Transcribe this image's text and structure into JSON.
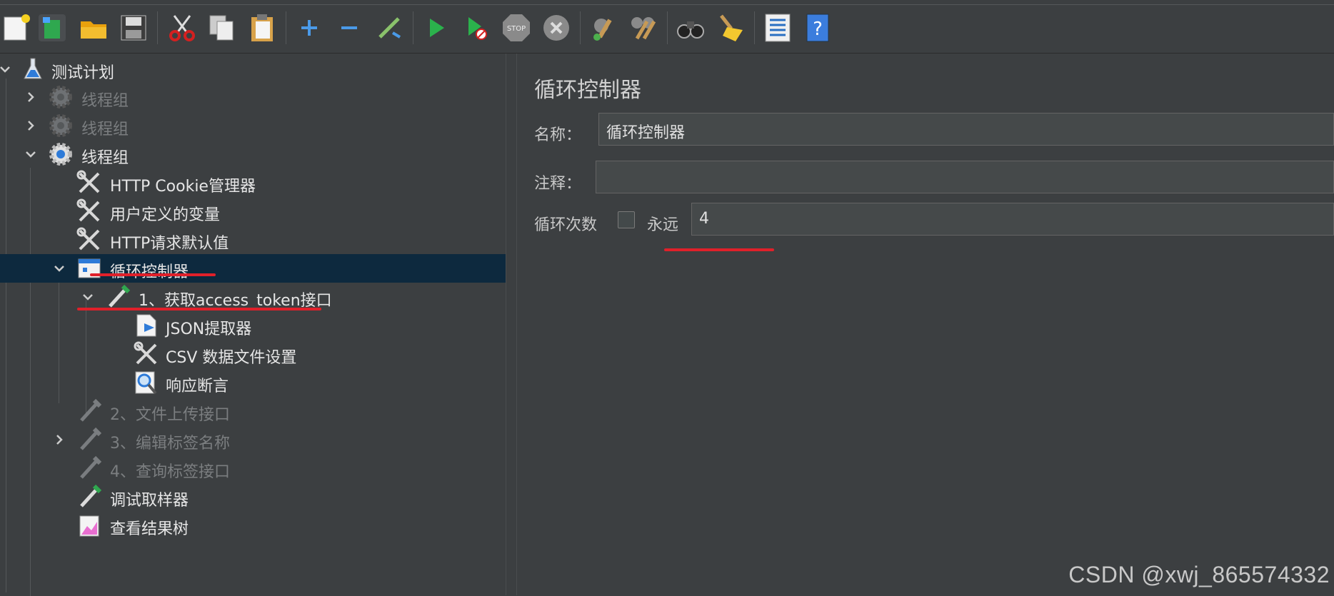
{
  "toolbar": {
    "buttons": [
      {
        "name": "new-icon"
      },
      {
        "name": "templates-icon"
      },
      {
        "name": "open-icon"
      },
      {
        "name": "save-icon"
      },
      {
        "name": "cut-icon"
      },
      {
        "name": "copy-icon"
      },
      {
        "name": "paste-icon"
      },
      {
        "name": "expand-icon"
      },
      {
        "name": "collapse-icon"
      },
      {
        "name": "toggle-icon"
      },
      {
        "name": "start-icon"
      },
      {
        "name": "start-no-pause-icon"
      },
      {
        "name": "stop-icon"
      },
      {
        "name": "shutdown-icon"
      },
      {
        "name": "clear-icon"
      },
      {
        "name": "clear-all-icon"
      },
      {
        "name": "search-icon"
      },
      {
        "name": "reset-search-icon"
      },
      {
        "name": "function-helper-icon"
      },
      {
        "name": "help-icon"
      }
    ]
  },
  "tree": {
    "root": "测试计划",
    "thread_group_1": "线程组",
    "thread_group_2": "线程组",
    "thread_group_3": "线程组",
    "cookie_manager": "HTTP Cookie管理器",
    "user_vars": "用户定义的变量",
    "http_defaults": "HTTP请求默认值",
    "loop_controller": "循环控制器",
    "sampler_1": "1、获取access_token接口",
    "json_extractor": "JSON提取器",
    "csv_config": "CSV 数据文件设置",
    "assertion": "响应断言",
    "sampler_2": "2、文件上传接口",
    "sampler_3": "3、编辑标签名称",
    "sampler_4": "4、查询标签接口",
    "debug_sampler": "调试取样器",
    "result_tree": "查看结果树"
  },
  "panel": {
    "title": "循环控制器",
    "name_label": "名称：",
    "name_value": "循环控制器",
    "comment_label": "注释：",
    "comment_value": "",
    "loop_label": "循环次数",
    "forever_label": "永远",
    "forever_checked": false,
    "loop_value": "4"
  },
  "watermark": "CSDN @xwj_865574332"
}
